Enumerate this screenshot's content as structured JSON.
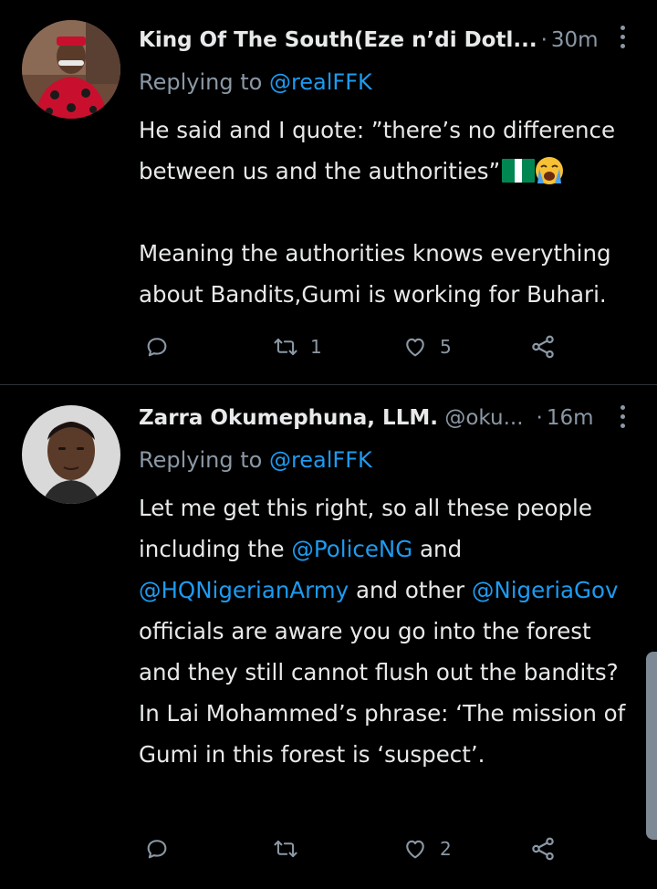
{
  "colors": {
    "background": "#000000",
    "text": "#e7e9ea",
    "secondary": "#8b98a5",
    "link": "#1d9bf0",
    "divider": "#2f3336"
  },
  "tweets": [
    {
      "name": "King Of The South(Eze n’di Dotl...",
      "separator": "·",
      "time": "30m",
      "reply_prefix": "Replying to",
      "reply_to": "@realFFK",
      "paragraphs": [
        "He said and I quote: ”there’s no difference between us and the authorities”",
        "Meaning the authorities knows everything about Bandits,Gumi is working for Buhari."
      ],
      "emoji": [
        "nigeria-flag",
        "loudly-crying-face"
      ],
      "actions": {
        "reply_count": "",
        "retweet_count": "1",
        "like_count": "5"
      }
    },
    {
      "name": "Zarra Okumephuna, LLM.",
      "handle": "@oku...",
      "separator": "·",
      "time": "16m",
      "reply_prefix": "Replying to",
      "reply_to": "@realFFK",
      "body": {
        "t1": "Let me get this right, so all these people including the ",
        "m1": "@PoliceNG",
        "t2": " and ",
        "m2": "@HQNigerianArmy",
        "t3": " and other ",
        "m3": "@NigeriaGov",
        "t4": " officials are aware you go into the forest and they still cannot flush out the bandits? In Lai Mohammed’s phrase: ‘The mission of Gumi in this forest is ‘suspect’."
      },
      "actions": {
        "reply_count": "",
        "retweet_count": "",
        "like_count": "2"
      }
    }
  ],
  "icons": {
    "reply": "reply-icon",
    "retweet": "retweet-icon",
    "like": "heart-icon",
    "share": "share-icon",
    "more": "more-vertical-icon"
  }
}
